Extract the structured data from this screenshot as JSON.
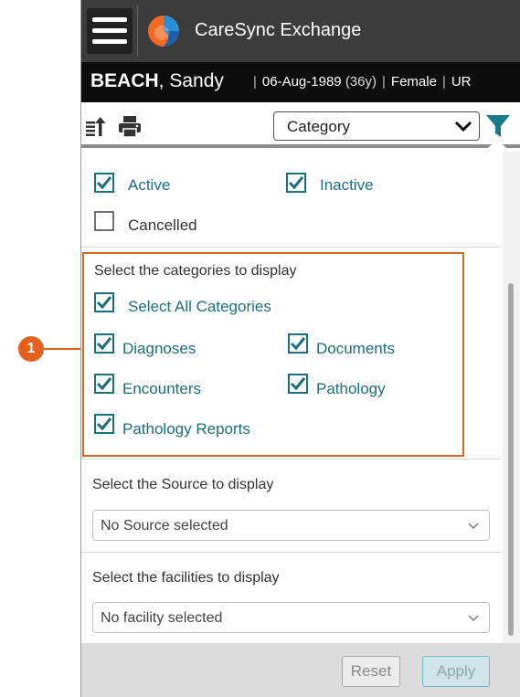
{
  "app": {
    "title": "CareSync Exchange"
  },
  "patient": {
    "last_name": "BEACH",
    "first_name": ", Sandy",
    "dob": "06-Aug-1989",
    "age": "(36y)",
    "gender": "Female",
    "truncated": "UR"
  },
  "toolbar": {
    "category_select_value": "Category"
  },
  "status_filters": [
    {
      "label": "Active",
      "checked": true
    },
    {
      "label": "Inactive",
      "checked": true
    },
    {
      "label": "Cancelled",
      "checked": false
    }
  ],
  "categories": {
    "title": "Select the categories to display",
    "select_all": {
      "label": "Select All Categories",
      "checked": true
    },
    "items": [
      {
        "label": "Diagnoses",
        "checked": true
      },
      {
        "label": "Documents",
        "checked": true
      },
      {
        "label": "Encounters",
        "checked": true
      },
      {
        "label": "Pathology",
        "checked": true
      },
      {
        "label": "Pathology Reports",
        "checked": true
      }
    ]
  },
  "source": {
    "title": "Select the Source to display",
    "value": "No Source selected"
  },
  "facilities": {
    "title": "Select the facilities to display",
    "value": "No facility selected"
  },
  "footer": {
    "reset_label": "Reset",
    "apply_label": "Apply"
  },
  "callout": {
    "number": "1"
  },
  "colors": {
    "accent_teal": "#1d6f79",
    "highlight_orange": "#d2692a"
  }
}
